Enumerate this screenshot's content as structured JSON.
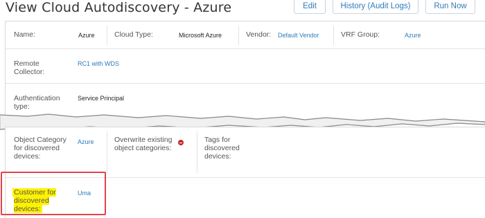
{
  "header": {
    "title": "View Cloud Autodiscovery - Azure",
    "buttons": {
      "edit": "Edit",
      "history": "History (Audit Logs)",
      "run": "Run Now"
    }
  },
  "row1": {
    "name_label": "Name:",
    "name_value": "Azure",
    "cloud_type_label": "Cloud Type:",
    "cloud_type_value": "Microsoft Azure",
    "vendor_label": "Vendor:",
    "vendor_value": "Default Vendor",
    "vrf_label": "VRF Group:",
    "vrf_value": "Azure"
  },
  "row2": {
    "label": "Remote Collector:",
    "value": "RC1 with WDS"
  },
  "row3": {
    "label": "Authentication type:",
    "value": "Service Principal"
  },
  "row4": {
    "category_label": "Object Category for discovered devices:",
    "category_value": "Azure",
    "overwrite_label": "Overwrite existing object categories:",
    "tags_label": "Tags for discovered devices:"
  },
  "row5": {
    "label": "Customer for discovered devices:",
    "value": "Uma"
  },
  "colors": {
    "accent": "#2e7bb8",
    "highlight": "#fff200",
    "callout": "#e0434b",
    "error": "#c62828"
  },
  "icons": {
    "overwrite_status": "no-entry-icon"
  }
}
